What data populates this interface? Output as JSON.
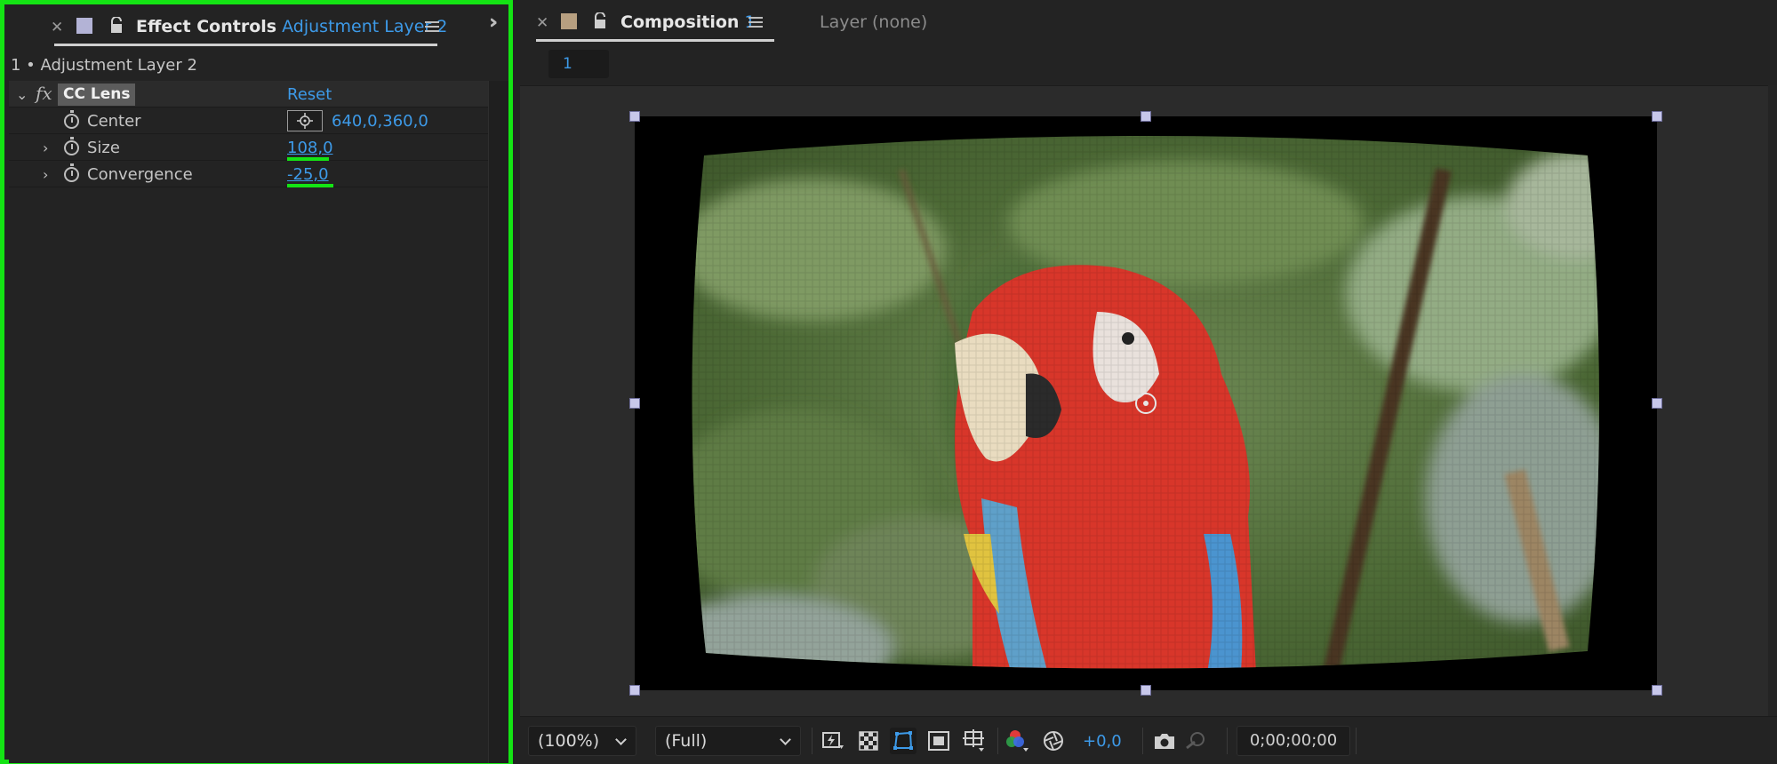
{
  "effect_controls": {
    "tab_title": "Effect Controls",
    "tab_layer": "Adjustment Layer 2",
    "layer_header": "1 • Adjustment Layer 2",
    "effect": {
      "fx_label": "fx",
      "name": "CC Lens",
      "reset_label": "Reset",
      "properties": [
        {
          "name": "Center",
          "value": "640,0,360,0"
        },
        {
          "name": "Size",
          "value": "108,0"
        },
        {
          "name": "Convergence",
          "value": "-25,0"
        }
      ]
    },
    "highlight_color": "#14e414"
  },
  "composition": {
    "tab_title": "Composition",
    "tab_number": "1",
    "layer_tab": "Layer (none)",
    "subtab": "1",
    "image_subject": "scarlet macaw parrot photo with CC Lens distortion"
  },
  "toolbar": {
    "zoom": "(100%)",
    "resolution": "(Full)",
    "exposure": "+0,0",
    "timecode": "0;00;00;00",
    "icons": [
      "fast-preview-icon",
      "transparency-grid-icon",
      "mask-visibility-icon",
      "region-of-interest-icon",
      "grid-guides-icon",
      "color-channels-icon",
      "reset-exposure-icon",
      "snapshot-icon",
      "show-snapshot-icon"
    ]
  },
  "colors": {
    "accent": "#3d9ae8",
    "panel_bg": "#232323"
  }
}
